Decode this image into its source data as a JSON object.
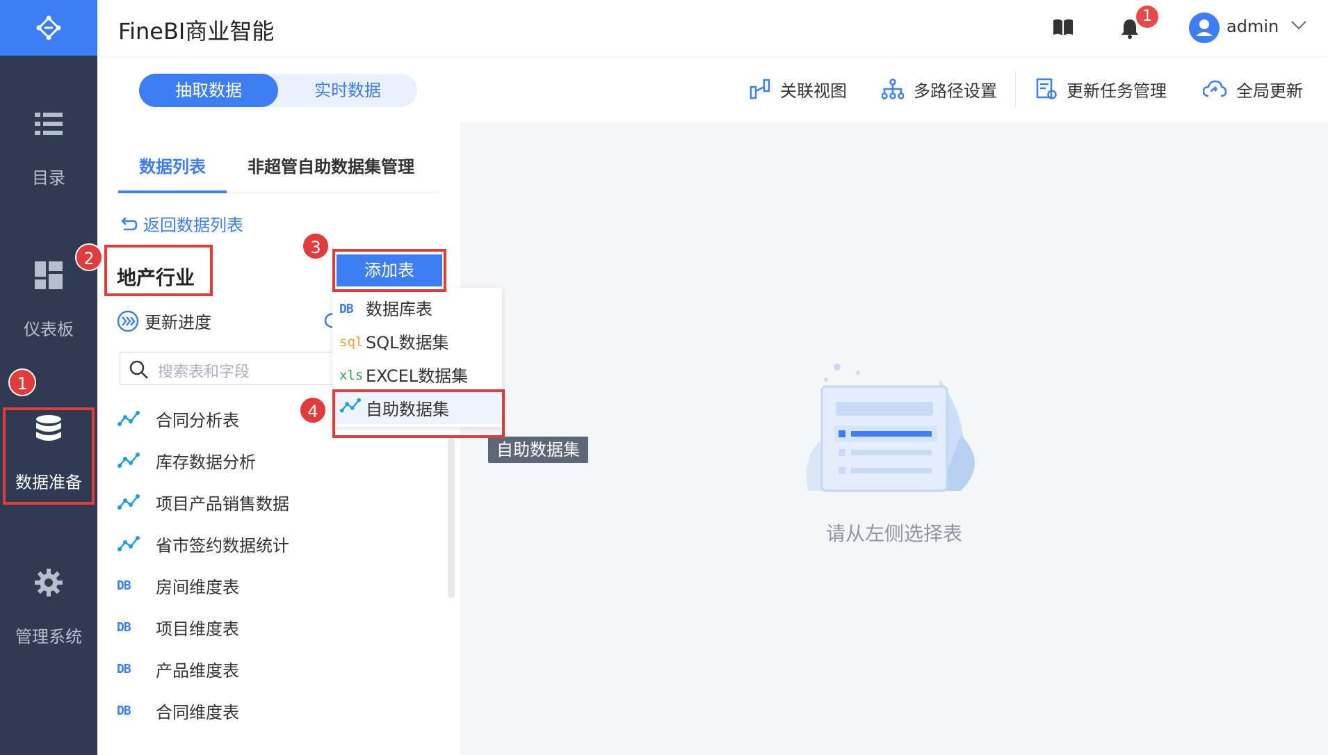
{
  "app": {
    "title": "FineBI商业智能"
  },
  "nav": {
    "items": [
      {
        "label": "目录",
        "icon": "catalog-icon"
      },
      {
        "label": "仪表板",
        "icon": "dashboard-icon"
      },
      {
        "label": "数据准备",
        "icon": "database-icon"
      },
      {
        "label": "管理系统",
        "icon": "gear-icon"
      }
    ]
  },
  "header": {
    "notification_count": "1",
    "username": "admin"
  },
  "toolbar": {
    "toggle": {
      "left": "抽取数据",
      "right": "实时数据"
    },
    "actions": [
      "关联视图",
      "多路径设置",
      "更新任务管理",
      "全局更新"
    ]
  },
  "panel": {
    "tabs": [
      "数据列表",
      "非超管自助数据集管理"
    ],
    "back_link": "返回数据列表",
    "section_title": "地产行业",
    "update_progress": "更新进度",
    "search_placeholder": "搜索表和字段",
    "items": [
      {
        "label": "合同分析表",
        "type": "self-service"
      },
      {
        "label": "库存数据分析",
        "type": "self-service"
      },
      {
        "label": "项目产品销售数据",
        "type": "self-service"
      },
      {
        "label": "省市签约数据统计",
        "type": "self-service"
      },
      {
        "label": "房间维度表",
        "type": "db",
        "tag": "DB"
      },
      {
        "label": "项目维度表",
        "type": "db",
        "tag": "DB"
      },
      {
        "label": "产品维度表",
        "type": "db",
        "tag": "DB"
      },
      {
        "label": "合同维度表",
        "type": "db",
        "tag": "DB"
      }
    ]
  },
  "add_table": {
    "button": "添加表",
    "menu": [
      {
        "tag": "DB",
        "label": "数据库表"
      },
      {
        "tag": "sql",
        "label": "SQL数据集"
      },
      {
        "tag": "xls",
        "label": "EXCEL数据集"
      },
      {
        "tag": "",
        "label": "自助数据集"
      }
    ],
    "tooltip": "自助数据集"
  },
  "content": {
    "empty_text": "请从左侧选择表"
  },
  "annotations": [
    "1",
    "2",
    "3",
    "4"
  ],
  "colors": {
    "accent": "#3d7ef4",
    "nav_bg": "#2e3b52",
    "annotation": "#e03c3c"
  }
}
